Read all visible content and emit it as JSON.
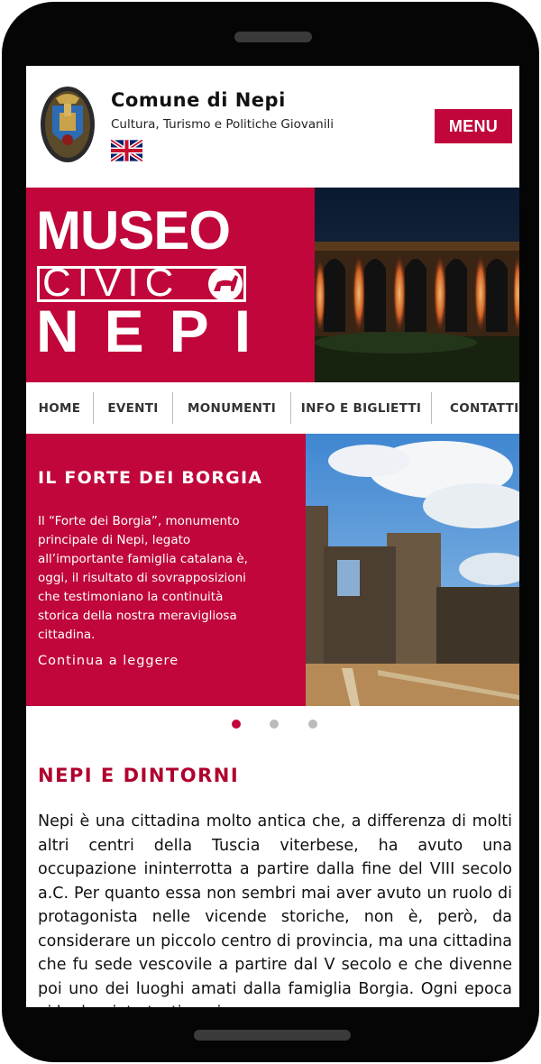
{
  "header": {
    "title": "Comune di Nepi",
    "subtitle": "Cultura, Turismo e Politiche Giovanili",
    "menu_label": "MENU",
    "crest_icon": "municipal-crest-icon",
    "flag_icon": "uk-flag-icon"
  },
  "banner": {
    "logo_line1": "MUSEO",
    "logo_line2": "CIVIC",
    "logo_line3": "NEPI"
  },
  "nav": {
    "items": [
      {
        "label": "HOME"
      },
      {
        "label": "EVENTI"
      },
      {
        "label": "MONUMENTI"
      },
      {
        "label": "INFO E BIGLIETTI"
      },
      {
        "label": "CONTATTI"
      }
    ]
  },
  "slide": {
    "title": "IL FORTE DEI BORGIA",
    "text": "Il “Forte dei Borgia”, monumento principale di Nepi, legato all’importante famiglia catalana è, oggi, il risultato di sovrapposizioni che testimoniano la continuità storica della nostra meravigliosa cittadina.",
    "link": "Continua a leggere"
  },
  "carousel": {
    "active_index": 0,
    "count": 3
  },
  "section": {
    "title": "NEPI E DINTORNI",
    "text": "Nepi è una cittadina molto antica che, a differenza di molti altri centri della Tuscia viterbese, ha avuto una occupazione ininterrotta a partire dalla fine del VIII secolo a.C. Per quanto essa non sembri mai aver avuto un ruolo di protagonista nelle vicende storiche, non è, però, da considerare un piccolo centro di provincia, ma una cittadina che fu sede vescovile a partire dal V secolo e che divenne poi uno dei luoghi amati dalla famiglia Borgia. Ogni epoca vi ha lasciato testimonianze"
  },
  "colors": {
    "brand": "#c0063a",
    "section_title": "#b0002e"
  }
}
